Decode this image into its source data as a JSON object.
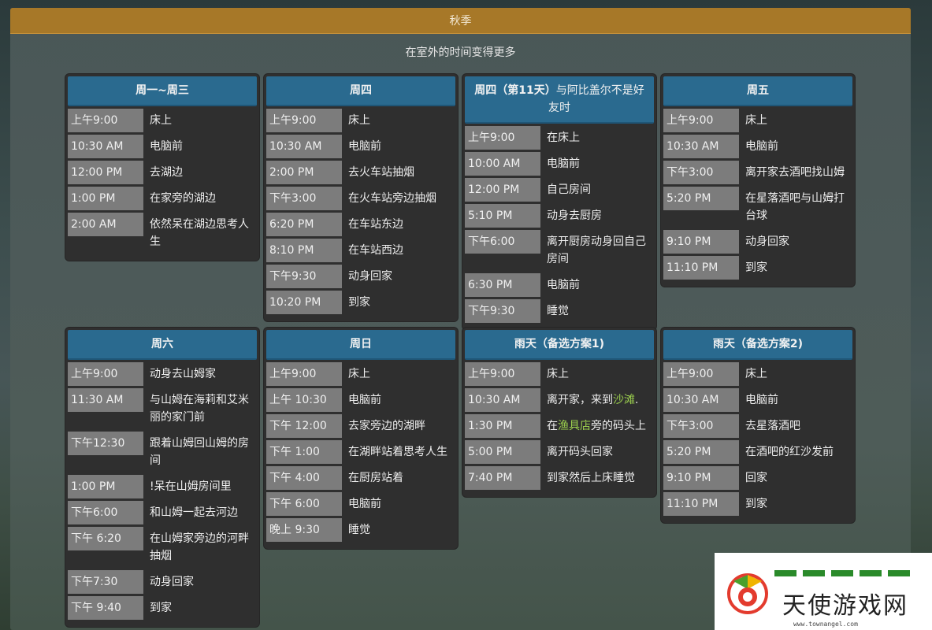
{
  "season": "秋季",
  "subtitle": "在室外的时间变得更多",
  "cards": [
    {
      "title": "周一~周三",
      "rows": [
        {
          "time": "上午9:00",
          "desc": "床上"
        },
        {
          "time": "10:30 AM",
          "desc": "电脑前"
        },
        {
          "time": "12:00 PM",
          "desc": "去湖边"
        },
        {
          "time": "1:00 PM",
          "desc": "在家旁的湖边"
        },
        {
          "time": "2:00 AM",
          "desc": "依然呆在湖边思考人生"
        }
      ]
    },
    {
      "title": "周四",
      "rows": [
        {
          "time": "上午9:00",
          "desc": "床上"
        },
        {
          "time": "10:30 AM",
          "desc": "电脑前"
        },
        {
          "time": "2:00 PM",
          "desc": "去火车站抽烟"
        },
        {
          "time": "下午3:00",
          "desc": "在火车站旁边抽烟"
        },
        {
          "time": "6:20 PM",
          "desc": "在车站东边"
        },
        {
          "time": "8:10 PM",
          "desc": "在车站西边"
        },
        {
          "time": "下午9:30",
          "desc": "动身回家"
        },
        {
          "time": "10:20 PM",
          "desc": "到家"
        }
      ]
    },
    {
      "title": "周四（第11天）",
      "title_extra": "与阿比盖尔不是好友时",
      "rows": [
        {
          "time": "上午9:00",
          "desc": "在床上"
        },
        {
          "time": "10:00 AM",
          "desc": "电脑前"
        },
        {
          "time": "12:00 PM",
          "desc": "自己房间"
        },
        {
          "time": "5:10 PM",
          "desc": "动身去厨房"
        },
        {
          "time": "下午6:00",
          "desc": "离开厨房动身回自己房间"
        },
        {
          "time": "6:30 PM",
          "desc": "电脑前"
        },
        {
          "time": "下午9:30",
          "desc": "睡觉"
        }
      ]
    },
    {
      "title": "周五",
      "rows": [
        {
          "time": "上午9:00",
          "desc": "床上"
        },
        {
          "time": "10:30 AM",
          "desc": "电脑前"
        },
        {
          "time": "下午3:00",
          "desc": "离开家去酒吧找山姆"
        },
        {
          "time": "5:20 PM",
          "desc": "在星落酒吧与山姆打台球"
        },
        {
          "time": "9:10 PM",
          "desc": "动身回家"
        },
        {
          "time": "11:10 PM",
          "desc": "到家"
        }
      ]
    },
    {
      "title": "周六",
      "rows": [
        {
          "time": "上午9:00",
          "desc": "动身去山姆家"
        },
        {
          "time": "11:30 AM",
          "desc": "与山姆在海莉和艾米丽的家门前"
        },
        {
          "time": "下午12:30",
          "desc": "跟着山姆回山姆的房间"
        },
        {
          "time": "1:00 PM",
          "desc": "!呆在山姆房间里"
        },
        {
          "time": "下午6:00",
          "desc": "和山姆一起去河边"
        },
        {
          "time": "下午 6:20",
          "desc": "在山姆家旁边的河畔抽烟"
        },
        {
          "time": "下午7:30",
          "desc": "动身回家"
        },
        {
          "time": "下午 9:40",
          "desc": "到家"
        }
      ]
    },
    {
      "title": "周日",
      "rows": [
        {
          "time": "上午9:00",
          "desc": "床上"
        },
        {
          "time": "上午 10:30",
          "desc": "电脑前"
        },
        {
          "time": "下午 12:00",
          "desc": "去家旁边的湖畔"
        },
        {
          "time": "下午 1:00",
          "desc": "在湖畔站着思考人生"
        },
        {
          "time": "下午 4:00",
          "desc": "在厨房站着"
        },
        {
          "time": "下午 6:00",
          "desc": "电脑前"
        },
        {
          "time": "晚上 9:30",
          "desc": "睡觉"
        }
      ]
    },
    {
      "title": "雨天（备选方案1)",
      "rows": [
        {
          "time": "上午9:00",
          "desc": "床上"
        },
        {
          "time": "10:30 AM",
          "desc_pre": "离开家，来到",
          "desc_link": "沙滩",
          "desc_post": "."
        },
        {
          "time": "1:30 PM",
          "desc_pre": "在",
          "desc_link": "渔具店",
          "desc_post": "旁的码头上"
        },
        {
          "time": "5:00 PM",
          "desc": "离开码头回家"
        },
        {
          "time": "7:40 PM",
          "desc": "到家然后上床睡觉"
        }
      ]
    },
    {
      "title": "雨天（备选方案2)",
      "rows": [
        {
          "time": "上午9:00",
          "desc": "床上"
        },
        {
          "time": "10:30 AM",
          "desc": "电脑前"
        },
        {
          "time": "下午3:00",
          "desc": "去星落酒吧"
        },
        {
          "time": "5:20 PM",
          "desc": "在酒吧的红沙发前"
        },
        {
          "time": "9:10 PM",
          "desc": "回家"
        },
        {
          "time": "11:10 PM",
          "desc": "到家"
        }
      ]
    }
  ],
  "watermark": {
    "name": "天使游戏网",
    "url": "www.townangel.com"
  }
}
